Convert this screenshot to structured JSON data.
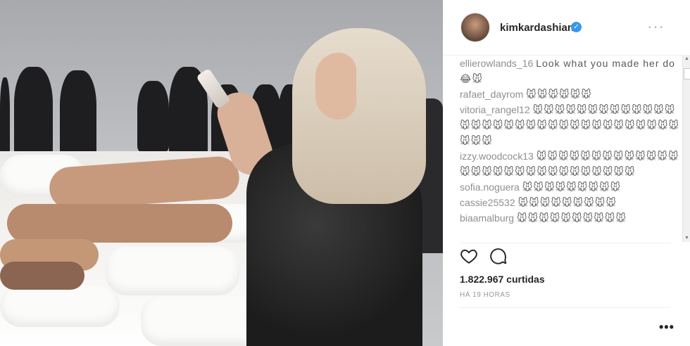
{
  "post": {
    "username": "kimkardashian",
    "verified_mark": "✓",
    "header_more": "•••",
    "likes": "1.822.967 curtidas",
    "timestamp": "HÁ 19 HORAS",
    "add_comment_placeholder": "",
    "footer_more": "•••"
  },
  "comments": [
    {
      "user": "ellierowlands_16",
      "text": "Look what you made her do 😂🐭",
      "faded": true
    },
    {
      "user": "rafaet_dayrom",
      "text": "🐭🐭🐭🐭🐭🐭",
      "faded": true
    },
    {
      "user": "vitoria_rangel12",
      "text": "🐭🐭🐭🐭🐭🐭🐭🐭🐭🐭🐭🐭🐭🐭🐭🐭🐭🐭🐭🐭🐭🐭🐭🐭🐭🐭🐭🐭🐭🐭🐭🐭🐭🐭🐭🐭",
      "faded": true
    },
    {
      "user": "izzy.woodcock13",
      "text": "🐭🐭🐭🐭🐭🐭🐭🐭🐭🐭🐭🐭🐭🐭🐭🐭🐭🐭🐭🐭🐭🐭🐭🐭🐭🐭🐭🐭🐭",
      "faded": true
    },
    {
      "user": "sofia.noguera",
      "text": "🐭🐭🐭🐭🐭🐭🐭🐭🐭",
      "faded": true
    },
    {
      "user": "cassie25532",
      "text": "🐭🐭🐭🐭🐭🐭🐭🐭🐭",
      "faded": true
    },
    {
      "user": "biaamalburg",
      "text": "🐭🐭🐭🐭🐭🐭🐭🐭🐭🐭",
      "faded": true
    }
  ],
  "icons": {
    "like": "heart-outline",
    "comment": "speech-bubble-outline"
  },
  "colors": {
    "verified": "#3897f0",
    "text": "#262626",
    "secondary": "#999999"
  }
}
